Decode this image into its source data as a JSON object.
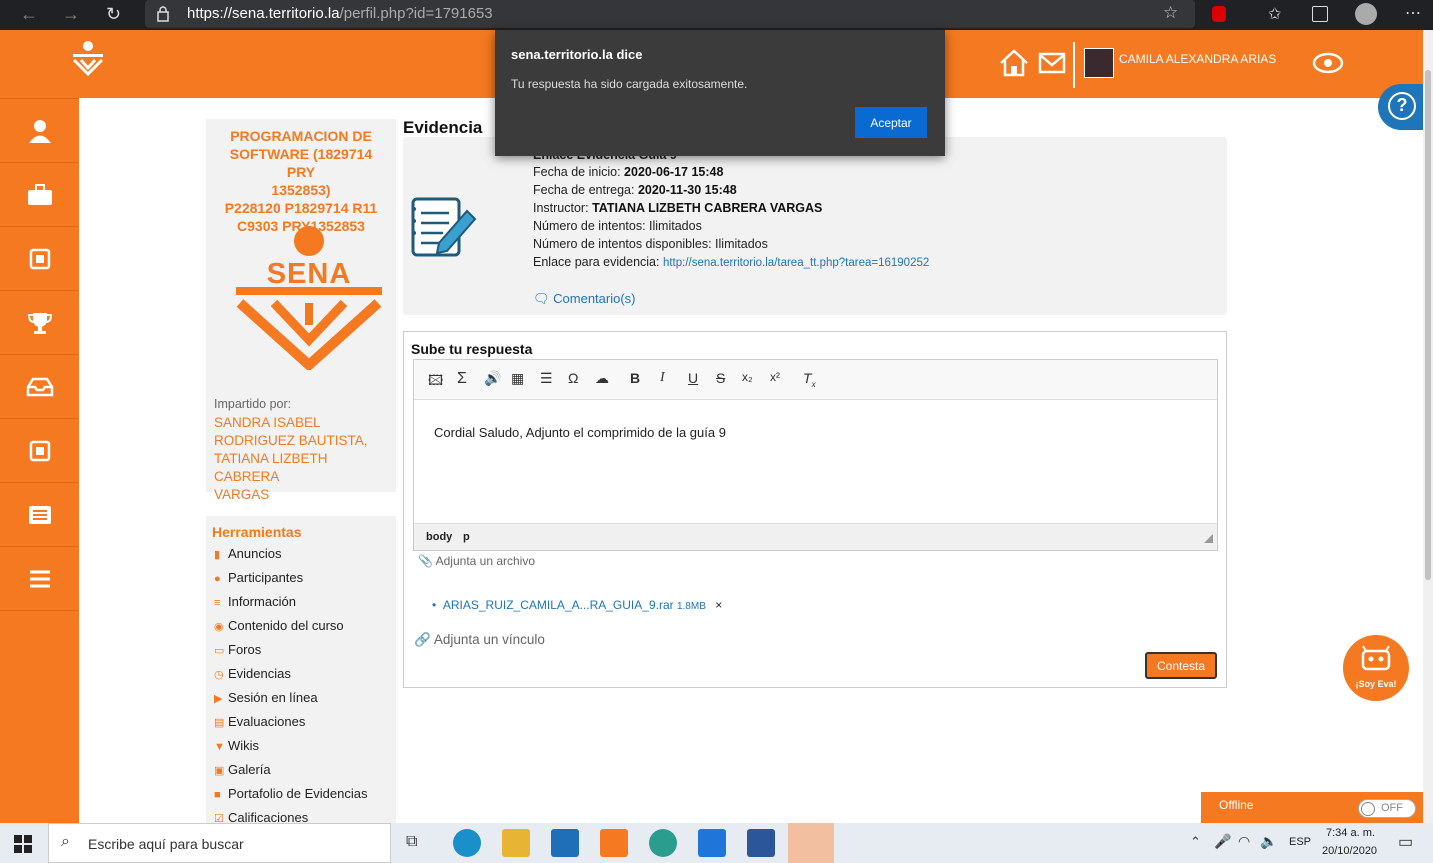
{
  "browser": {
    "url_host": "https://sena.territorio.la",
    "url_path": "/perfil.php?id=1791653"
  },
  "header": {
    "user_name": "CAMILA ALEXANDRA ARIAS",
    "help": "?"
  },
  "course": {
    "title_lines": [
      "PROGRAMACION DE",
      "SOFTWARE (1829714 PRY",
      "1352853)",
      "P228120 P1829714 R11",
      "C9303 PRY1352853"
    ],
    "logo_text": "SENA",
    "imparted_label": "Impartido por:",
    "instructors_lines": [
      "SANDRA ISABEL",
      "RODRIGUEZ BAUTISTA,",
      "TATIANA LIZBETH CABRERA",
      "VARGAS"
    ]
  },
  "tools": {
    "heading": "Herramientas",
    "items": [
      "Anuncios",
      "Participantes",
      "Información",
      "Contenido del curso",
      "Foros",
      "Evidencias",
      "Sesión en línea",
      "Evaluaciones",
      "Wikis",
      "Galería",
      "Portafolio de Evidencias",
      "Calificaciones"
    ]
  },
  "evidence": {
    "title": "Evidencia",
    "hidden_title": "Enlace Evidencia Guía 9",
    "start_label": "Fecha de inicio:",
    "start_value": "2020-06-17 15:48",
    "end_label": "Fecha de entrega:",
    "end_value": "2020-11-30 15:48",
    "instructor_label": "Instructor:",
    "instructor_value": "TATIANA LIZBETH CABRERA VARGAS",
    "attempts": "Número de intentos: Ilimitados",
    "attempts_available": "Número de intentos disponibles: Ilimitados",
    "link_label": "Enlace para evidencia:",
    "link_value": "http://sena.territorio.la/tarea_tt.php?tarea=16190252",
    "comments": "Comentario(s)"
  },
  "answer": {
    "heading": "Sube tu respuesta",
    "content": "Cordial Saludo, Adjunto el comprimido de la guía 9",
    "path_body": "body",
    "path_p": "p",
    "attach_file": "Adjunta un archivo",
    "file_name": "ARIAS_RUIZ_CAMILA_A...RA_GUIA_9.rar",
    "file_size": "1.8MB",
    "remove": "×",
    "attach_link": "Adjunta un vínculo",
    "submit": "Contesta"
  },
  "dialog": {
    "title": "sena.territorio.la dice",
    "message": "Tu respuesta ha sido cargada exitosamente.",
    "ok": "Aceptar"
  },
  "eva": {
    "label": "¡Soy Eva!"
  },
  "offline": {
    "label": "Offline",
    "toggle": "OFF"
  },
  "taskbar": {
    "search_placeholder": "Escribe aquí para buscar",
    "lang": "ESP",
    "time": "7:34 a. m.",
    "date": "20/10/2020"
  },
  "colors": {
    "accent": "#f47920",
    "link": "#1f75b9",
    "dialog_button": "#0a6ad1"
  }
}
